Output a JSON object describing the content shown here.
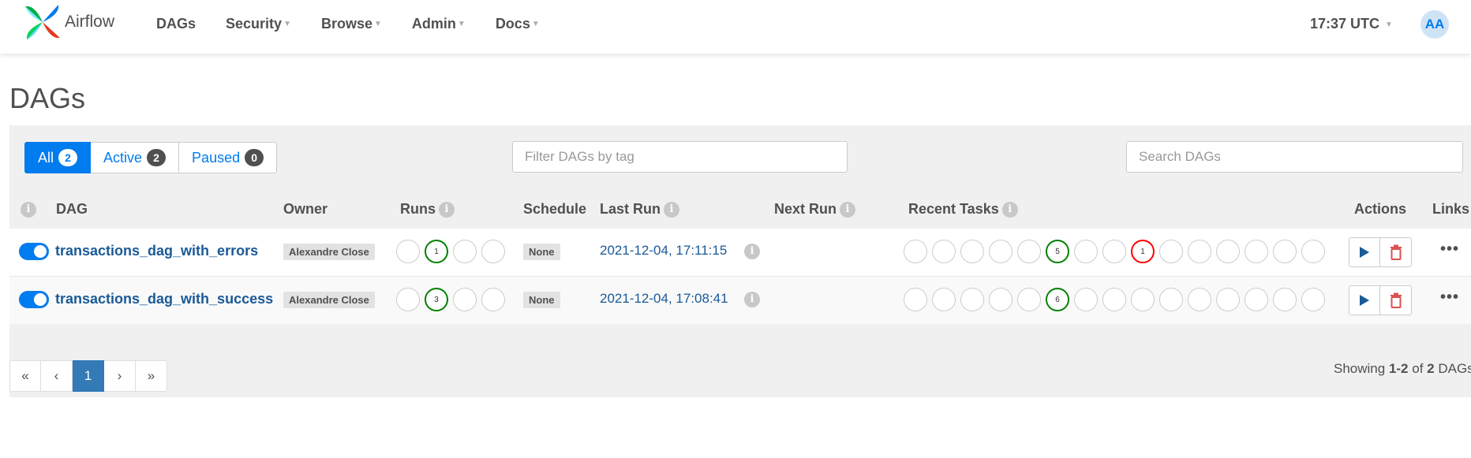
{
  "brand": {
    "name": "Airflow",
    "logo_icon": "airflow-pinwheel-icon"
  },
  "nav": {
    "items": [
      {
        "label": "DAGs",
        "dropdown": false
      },
      {
        "label": "Security",
        "dropdown": true
      },
      {
        "label": "Browse",
        "dropdown": true
      },
      {
        "label": "Admin",
        "dropdown": true
      },
      {
        "label": "Docs",
        "dropdown": true
      }
    ],
    "clock": "17:37 UTC",
    "avatar": "AA"
  },
  "page": {
    "title": "DAGs"
  },
  "filters": {
    "all": {
      "label": "All",
      "count": "2"
    },
    "active": {
      "label": "Active",
      "count": "2"
    },
    "paused": {
      "label": "Paused",
      "count": "0"
    },
    "tag_placeholder": "Filter DAGs by tag",
    "search_placeholder": "Search DAGs"
  },
  "table": {
    "headers": {
      "dag": "DAG",
      "owner": "Owner",
      "runs": "Runs",
      "schedule": "Schedule",
      "last_run": "Last Run",
      "next_run": "Next Run",
      "recent_tasks": "Recent Tasks",
      "actions": "Actions",
      "links": "Links"
    },
    "rows": [
      {
        "active": true,
        "dag_id": "transactions_dag_with_errors",
        "owner": "Alexandre Close",
        "runs": [
          {
            "state": "none",
            "count": ""
          },
          {
            "state": "success",
            "count": "1"
          },
          {
            "state": "none",
            "count": ""
          },
          {
            "state": "none",
            "count": ""
          }
        ],
        "schedule": "None",
        "last_run": "2021-12-04, 17:11:15",
        "next_run": "",
        "recent_tasks": [
          {
            "state": "none",
            "count": ""
          },
          {
            "state": "none",
            "count": ""
          },
          {
            "state": "none",
            "count": ""
          },
          {
            "state": "none",
            "count": ""
          },
          {
            "state": "none",
            "count": ""
          },
          {
            "state": "success",
            "count": "5"
          },
          {
            "state": "none",
            "count": ""
          },
          {
            "state": "none",
            "count": ""
          },
          {
            "state": "failed",
            "count": "1"
          },
          {
            "state": "none",
            "count": ""
          },
          {
            "state": "none",
            "count": ""
          },
          {
            "state": "none",
            "count": ""
          },
          {
            "state": "none",
            "count": ""
          },
          {
            "state": "none",
            "count": ""
          },
          {
            "state": "none",
            "count": ""
          }
        ],
        "links": "•••"
      },
      {
        "active": true,
        "dag_id": "transactions_dag_with_success",
        "owner": "Alexandre Close",
        "runs": [
          {
            "state": "none",
            "count": ""
          },
          {
            "state": "success",
            "count": "3"
          },
          {
            "state": "none",
            "count": ""
          },
          {
            "state": "none",
            "count": ""
          }
        ],
        "schedule": "None",
        "last_run": "2021-12-04, 17:08:41",
        "next_run": "",
        "recent_tasks": [
          {
            "state": "none",
            "count": ""
          },
          {
            "state": "none",
            "count": ""
          },
          {
            "state": "none",
            "count": ""
          },
          {
            "state": "none",
            "count": ""
          },
          {
            "state": "none",
            "count": ""
          },
          {
            "state": "success",
            "count": "6"
          },
          {
            "state": "none",
            "count": ""
          },
          {
            "state": "none",
            "count": ""
          },
          {
            "state": "none",
            "count": ""
          },
          {
            "state": "none",
            "count": ""
          },
          {
            "state": "none",
            "count": ""
          },
          {
            "state": "none",
            "count": ""
          },
          {
            "state": "none",
            "count": ""
          },
          {
            "state": "none",
            "count": ""
          },
          {
            "state": "none",
            "count": ""
          }
        ],
        "links": "•••"
      }
    ]
  },
  "pagination": {
    "first": "«",
    "prev": "‹",
    "current": "1",
    "next": "›",
    "last": "»",
    "showing_prefix": "Showing ",
    "showing_range": "1-2",
    "showing_of": " of ",
    "showing_total": "2",
    "showing_suffix": " DAGs"
  },
  "colors": {
    "primary": "#017cee",
    "success": "#008000",
    "failed": "#ff0000",
    "link": "#1a5a96",
    "delete": "#d9534f"
  }
}
